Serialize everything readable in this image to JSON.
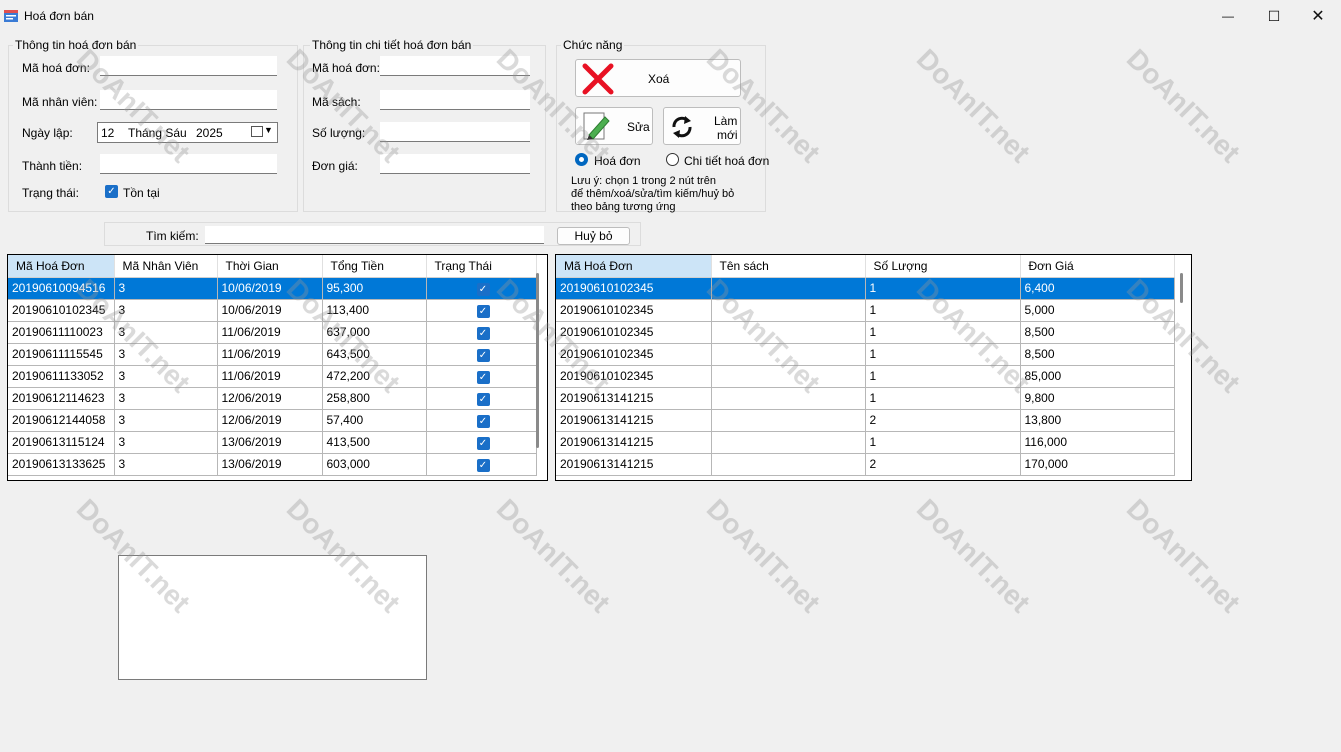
{
  "window": {
    "title": "Hoá đơn bán",
    "minimize": "—",
    "maximize": "☐",
    "close": "✕"
  },
  "invoice_info": {
    "title": "Thông tin hoá đơn bán",
    "ma_hd_label": "Mã hoá đơn:",
    "ma_hd_value": "",
    "ma_nv_label": "Mã nhân viên:",
    "ma_nv_value": "",
    "ngay_lap_label": "Ngày lập:",
    "ngay_day": "12",
    "ngay_month": "Tháng Sáu",
    "ngay_year": "2025",
    "thanh_tien_label": "Thành tiền:",
    "thanh_tien_value": "",
    "trang_thai_label": "Trạng thái:",
    "ton_tai_label": "Tồn tại"
  },
  "detail_info": {
    "title": "Thông tin chi tiết hoá đơn bán",
    "ma_hd_label": "Mã hoá đơn:",
    "ma_sach_label": "Mã sách:",
    "so_luong_label": "Số lượng:",
    "don_gia_label": "Đơn giá:"
  },
  "functions": {
    "title": "Chức năng",
    "delete_label": "Xoá",
    "edit_label": "Sửa",
    "refresh_label_1": "Làm",
    "refresh_label_2": "mới",
    "radio_invoice": "Hoá đơn",
    "radio_detail": "Chi tiết hoá đơn",
    "note_1": "Lưu ý: chọn 1 trong 2 nút trên",
    "note_2": "để thêm/xoá/sửa/tìm kiếm/huỷ bỏ",
    "note_3": "theo bảng tương ứng"
  },
  "search": {
    "label": "Tìm kiếm:",
    "value": "",
    "cancel_label": "Huỷ bỏ"
  },
  "invoices": {
    "headers": [
      "Mã Hoá Đơn",
      "Mã Nhân Viên",
      "Thời Gian",
      "Tổng Tiền",
      "Trạng Thái"
    ],
    "rows": [
      [
        "20190610094516",
        "3",
        "10/06/2019",
        "95,300"
      ],
      [
        "20190610102345",
        "3",
        "10/06/2019",
        "113,400"
      ],
      [
        "20190611110023",
        "3",
        "11/06/2019",
        "637,000"
      ],
      [
        "20190611115545",
        "3",
        "11/06/2019",
        "643,500"
      ],
      [
        "20190611133052",
        "3",
        "11/06/2019",
        "472,200"
      ],
      [
        "20190612114623",
        "3",
        "12/06/2019",
        "258,800"
      ],
      [
        "20190612144058",
        "3",
        "12/06/2019",
        "57,400"
      ],
      [
        "20190613115124",
        "3",
        "13/06/2019",
        "413,500"
      ],
      [
        "20190613133625",
        "3",
        "13/06/2019",
        "603,000"
      ]
    ]
  },
  "details": {
    "headers": [
      "Mã Hoá Đơn",
      "Tên sách",
      "Số Lượng",
      "Đơn Giá"
    ],
    "rows": [
      [
        "20190610102345",
        "",
        "1",
        "6,400"
      ],
      [
        "20190610102345",
        "",
        "1",
        "5,000"
      ],
      [
        "20190610102345",
        "",
        "1",
        "8,500"
      ],
      [
        "20190610102345",
        "",
        "1",
        "8,500"
      ],
      [
        "20190610102345",
        "",
        "1",
        "85,000"
      ],
      [
        "20190613141215",
        "",
        "1",
        "9,800"
      ],
      [
        "20190613141215",
        "",
        "2",
        "13,800"
      ],
      [
        "20190613141215",
        "",
        "1",
        "116,000"
      ],
      [
        "20190613141215",
        "",
        "2",
        "170,000"
      ]
    ]
  },
  "watermark": "DoAnIT.net",
  "colors": {
    "selection": "#0078d7",
    "header_selected": "#cce4f7",
    "delete_x": "#e81123",
    "checkbox": "#1a6fc8"
  }
}
